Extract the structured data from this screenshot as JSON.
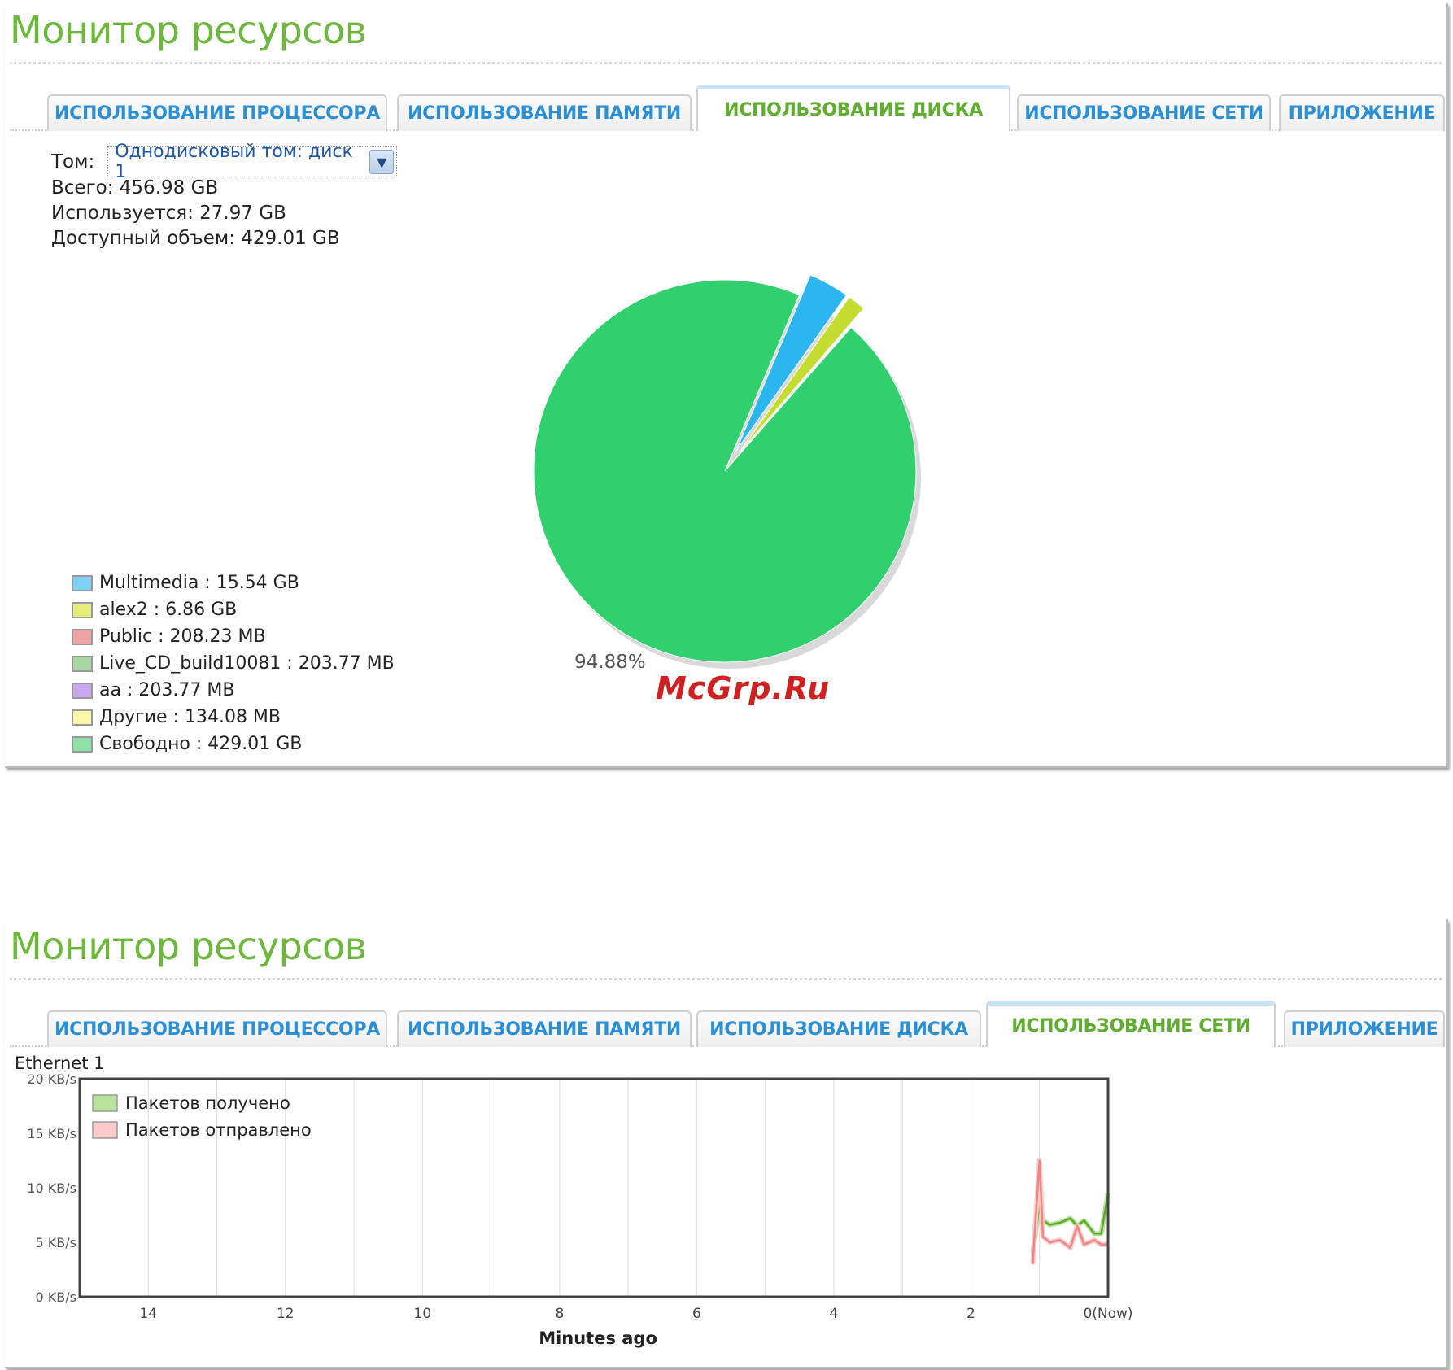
{
  "app_title": "Монитор ресурсов",
  "tabs": [
    {
      "label": "ИСПОЛЬЗОВАНИЕ ПРОЦЕССОРА"
    },
    {
      "label": "ИСПОЛЬЗОВАНИЕ ПАМЯТИ"
    },
    {
      "label": "ИСПОЛЬЗОВАНИЕ ДИСКА"
    },
    {
      "label": "ИСПОЛЬЗОВАНИЕ СЕТИ"
    },
    {
      "label": "ПРИЛОЖЕНИЕ"
    }
  ],
  "disk_view": {
    "active_tab": "ИСПОЛЬЗОВАНИЕ ДИСКА",
    "volume_label": "Том:",
    "volume_value": "Однодисковый том: диск 1",
    "total": "Всего: 456.98 GB",
    "used": "Используется: 27.97 GB",
    "available": "Доступный объем: 429.01 GB",
    "pie_percent_label": "94.88%",
    "legend": [
      {
        "label": "Multimedia : 15.54 GB",
        "color": "#7fd0f5"
      },
      {
        "label": "alex2 : 6.86 GB",
        "color": "#e4ec7a"
      },
      {
        "label": "Public : 208.23 MB",
        "color": "#f0a3a3"
      },
      {
        "label": "Live_CD_build10081 : 203.77 MB",
        "color": "#a8d7a4"
      },
      {
        "label": "aa : 203.77 MB",
        "color": "#c9a8f0"
      },
      {
        "label": "Другие : 134.08 MB",
        "color": "#fbf7a6"
      },
      {
        "label": "Свободно : 429.01 GB",
        "color": "#8fe2a6"
      }
    ]
  },
  "watermark": "McGrp.Ru",
  "net_view": {
    "active_tab": "ИСПОЛЬЗОВАНИЕ СЕТИ",
    "interface": "Ethernet 1"
  },
  "chart_data": [
    {
      "type": "pie",
      "title": "",
      "categories": [
        "Multimedia",
        "alex2",
        "Public",
        "Live_CD_build10081",
        "aa",
        "Другие",
        "Свободно"
      ],
      "values_gb": [
        15.54,
        6.86,
        0.20335,
        0.19899,
        0.19899,
        0.13094,
        429.01
      ],
      "colors": [
        "#2bb6ef",
        "#c4db2f",
        "#e07070",
        "#6fbf6a",
        "#a57ee6",
        "#f3ec72",
        "#2fd06d"
      ],
      "data_label": "94.88%"
    },
    {
      "type": "line",
      "title": "",
      "xlabel": "Minutes ago",
      "ylabel": "",
      "xlim": [
        15,
        0
      ],
      "ylim": [
        0,
        20
      ],
      "x_ticks": [
        "14",
        "12",
        "10",
        "8",
        "6",
        "4",
        "2",
        "0(Now)"
      ],
      "x_tick_values": [
        14,
        12,
        10,
        8,
        6,
        4,
        2,
        0
      ],
      "y_ticks": [
        "0 KB/s",
        "5 KB/s",
        "10 KB/s",
        "15 KB/s",
        "20 KB/s"
      ],
      "y_tick_values": [
        0,
        5,
        10,
        15,
        20
      ],
      "grid": true,
      "legend_position": "top-left",
      "series": [
        {
          "name": "Пакетов получено",
          "color": "#5ca92b",
          "fill": "#b9e29b",
          "x": [
            1.1,
            1.0,
            0.95,
            0.85,
            0.7,
            0.55,
            0.45,
            0.35,
            0.2,
            0.1,
            0.0
          ],
          "values": [
            4.0,
            8.5,
            7.0,
            6.6,
            6.8,
            7.2,
            6.5,
            7.0,
            5.8,
            5.8,
            9.5
          ]
        },
        {
          "name": "Пакетов отправлено",
          "color": "#f08585",
          "fill": "#fbcaca",
          "x": [
            1.1,
            1.0,
            0.95,
            0.85,
            0.7,
            0.55,
            0.45,
            0.35,
            0.2,
            0.1,
            0.0
          ],
          "values": [
            3.0,
            12.5,
            5.5,
            5.0,
            5.2,
            4.5,
            6.5,
            4.8,
            5.2,
            4.8,
            4.8
          ]
        }
      ]
    }
  ]
}
